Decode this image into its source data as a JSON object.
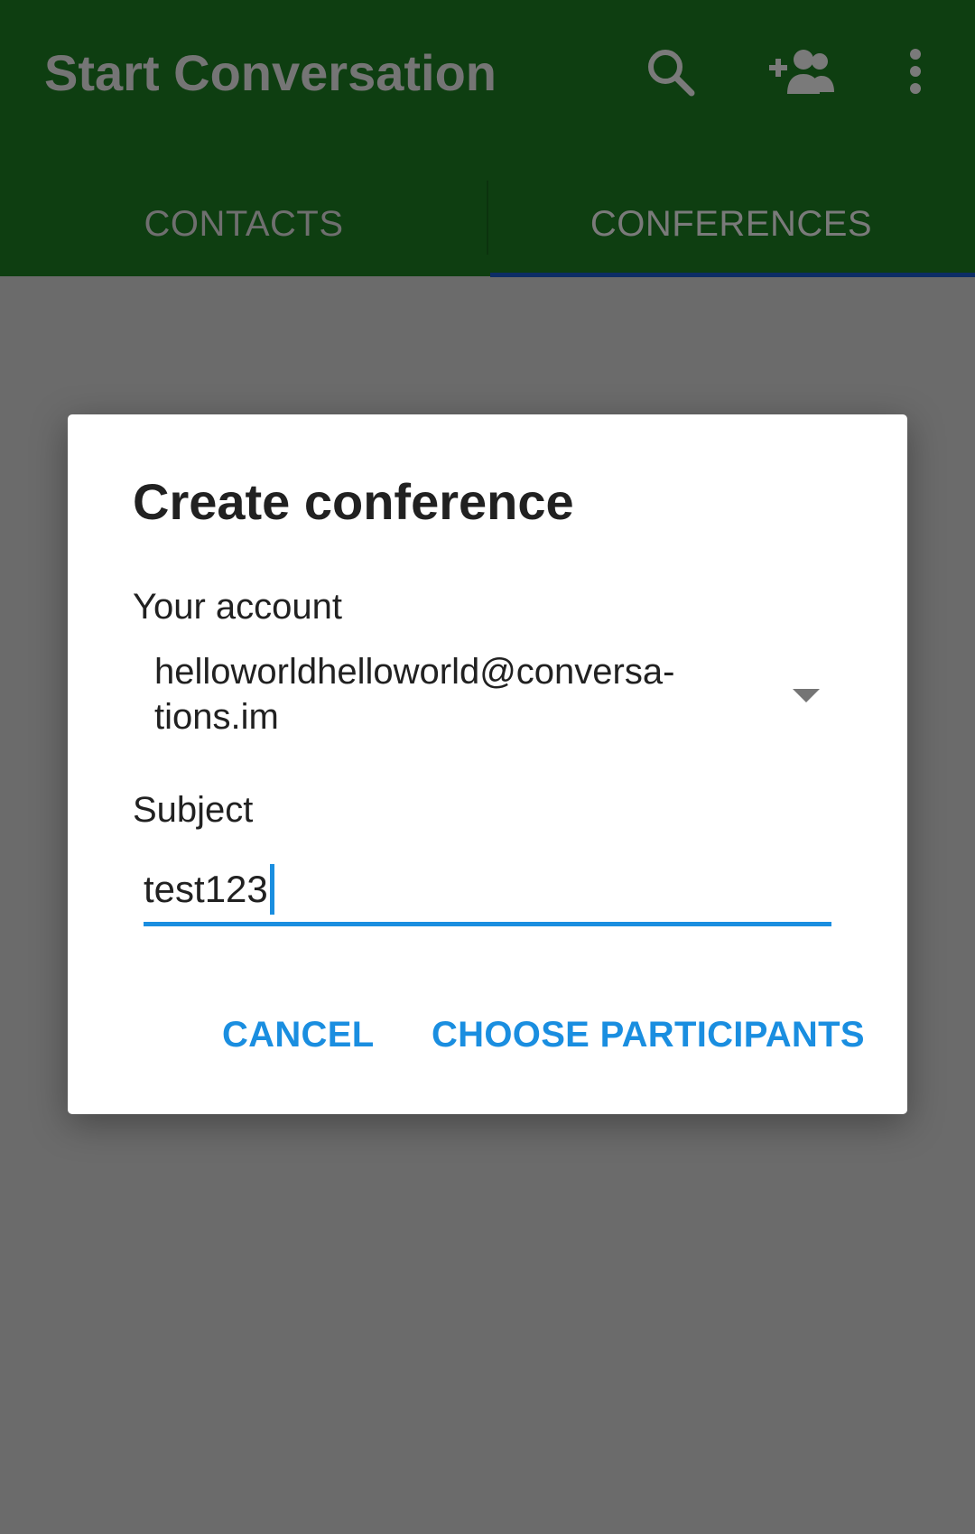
{
  "app_bar": {
    "title": "Start Conversation",
    "actions": [
      {
        "icon": "search-icon"
      },
      {
        "icon": "add-group-icon"
      },
      {
        "icon": "more-vert-icon"
      }
    ],
    "background": "#0e3e11"
  },
  "tabs": [
    {
      "label": "CONTACTS",
      "selected": false
    },
    {
      "label": "CONFERENCES",
      "selected": true
    }
  ],
  "dialog": {
    "title": "Create conference",
    "account_label": "Your account",
    "account_value": "helloworldhelloworld@conversa-\ntions.im",
    "subject_label": "Subject",
    "subject_value": "test123",
    "buttons": {
      "cancel": "CANCEL",
      "choose_participants": "CHOOSE PARTICIPANTS"
    },
    "accent": "#1a8ee0"
  }
}
